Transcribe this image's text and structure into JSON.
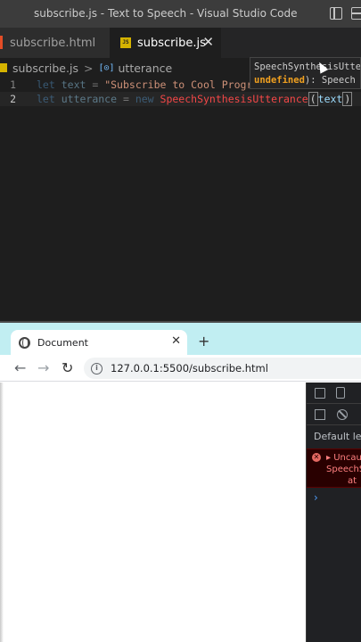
{
  "vscode": {
    "window_title": "subscribe.js - Text to Speech - Visual Studio Code",
    "tabs": [
      {
        "label": "subscribe.html",
        "active": false
      },
      {
        "label": "subscribe.js",
        "active": true,
        "icon": "JS"
      }
    ],
    "tab_close": "✕",
    "breadcrumb": {
      "file": "subscribe.js",
      "separator": ">",
      "symbol_icon": "[⊙]",
      "symbol": "utterance"
    },
    "code_lines": [
      {
        "number": "1",
        "kw": "let",
        "name": "text",
        "op": " = ",
        "value": "\"Subscribe to Cool Progra"
      },
      {
        "number": "2",
        "kw": "let",
        "name": "utterance",
        "op": " = ",
        "kw2": "new",
        "cls": "SpeechSynthesisUtterance",
        "open": "(",
        "arg": "text",
        "close": ")"
      }
    ],
    "hint": {
      "line1": "SpeechSynthesisUtte",
      "line2_bold": "undefined",
      "line2_rest": "): Speech"
    }
  },
  "chrome": {
    "tab_title": "Document",
    "tab_close": "✕",
    "new_tab": "+",
    "nav": {
      "back": "←",
      "forward": "→",
      "reload": "↻"
    },
    "address": "127.0.0.1:5500/subscribe.html",
    "info_icon": "i"
  },
  "devtools": {
    "levels_label": "Default leve",
    "error": {
      "icon": "✕",
      "line1": "▸ Uncau",
      "line2": "SpeechS",
      "line3": "at"
    },
    "prompt": "›"
  }
}
